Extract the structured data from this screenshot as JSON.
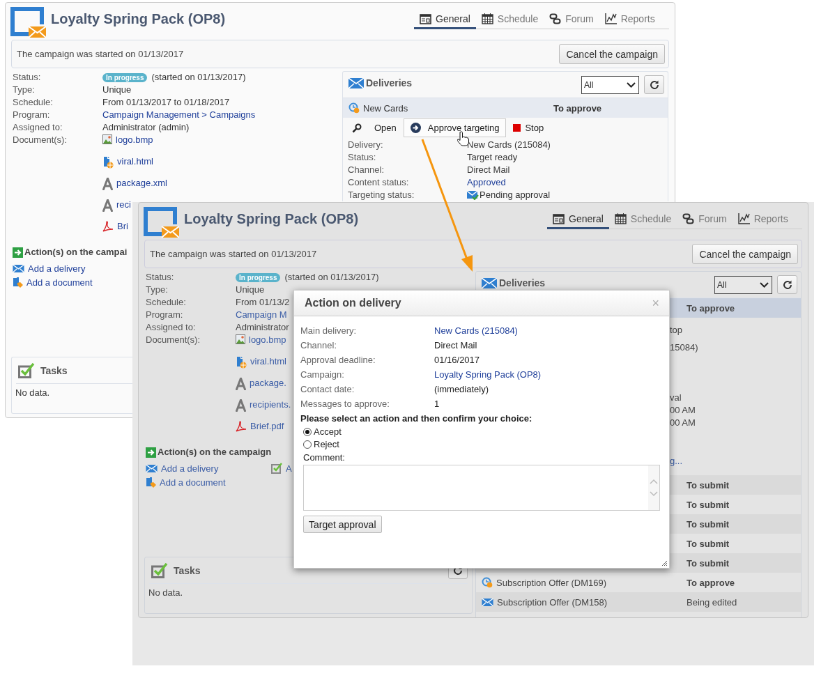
{
  "back_screen": {
    "dimmed": false,
    "title": "Loyalty Spring Pack (OP8)",
    "tabs": [
      {
        "kind": "general",
        "label": "General",
        "selected": true
      },
      {
        "kind": "schedule",
        "label": "Schedule",
        "selected": false
      },
      {
        "kind": "forum",
        "label": "Forum",
        "selected": false
      },
      {
        "kind": "reports",
        "label": "Reports",
        "selected": false
      }
    ],
    "banner": {
      "message": "The campaign was started on 01/13/2017",
      "button": "Cancel the campaign"
    },
    "details": [
      {
        "label": "Status:",
        "badge": "In progress",
        "value": "(started on 01/13/2017)",
        "link": false
      },
      {
        "label": "Type:",
        "value": "Unique",
        "link": false
      },
      {
        "label": "Schedule:",
        "value": "From 01/13/2017 to 01/18/2017",
        "link": false
      },
      {
        "label": "Program:",
        "value": "Campaign Management > Campaigns",
        "link": true
      },
      {
        "label": "Assigned to:",
        "value": "Administrator (admin)",
        "link": false
      }
    ],
    "documents_label": "Document(s):",
    "documents": [
      {
        "kind": "image",
        "name": "logo.bmp"
      },
      {
        "kind": "web",
        "name": "viral.html"
      },
      {
        "kind": "text",
        "name": "package.xml"
      },
      {
        "kind": "text",
        "name": "reci"
      },
      {
        "kind": "pdf",
        "name": "Bri"
      }
    ],
    "actions_title": "Action(s) on the campai",
    "actions": [
      {
        "kind": "delivery",
        "label": "Add a delivery"
      },
      {
        "kind": "document",
        "label": "Add a document"
      }
    ],
    "tasks": {
      "title": "Tasks",
      "empty": "No data.",
      "refresh_button": false
    },
    "deliveries": {
      "title": "Deliveries",
      "filter": "All",
      "rows": [
        {
          "name": "New Cards",
          "status": "To approve",
          "awaiting": true,
          "selected": true,
          "actions": [
            {
              "kind": "open",
              "label": "Open",
              "hovered": false
            },
            {
              "kind": "approve",
              "label": "Approve targeting",
              "hovered": true
            },
            {
              "kind": "stop",
              "label": "Stop",
              "hovered": false
            }
          ],
          "details": [
            {
              "label": "Delivery:",
              "value": "New Cards (215084)",
              "kind": "plain"
            },
            {
              "label": "Status:",
              "value": "Target ready",
              "kind": "plain"
            },
            {
              "label": "Channel:",
              "value": "Direct Mail",
              "kind": "plain"
            },
            {
              "label": "Content status:",
              "value": "Approved",
              "kind": "link"
            },
            {
              "label": "Targeting status:",
              "value": "Pending approval",
              "kind": "mail"
            }
          ]
        }
      ]
    }
  },
  "front_screen": {
    "dimmed": true,
    "title": "Loyalty Spring Pack (OP8)",
    "tabs": [
      {
        "kind": "general",
        "label": "General",
        "selected": true
      },
      {
        "kind": "schedule",
        "label": "Schedule",
        "selected": false
      },
      {
        "kind": "forum",
        "label": "Forum",
        "selected": false
      },
      {
        "kind": "reports",
        "label": "Reports",
        "selected": false
      }
    ],
    "banner": {
      "message": "The campaign was started on 01/13/2017",
      "button": "Cancel the campaign"
    },
    "details": [
      {
        "label": "Status:",
        "badge": "In progress",
        "value": "(started on 01/13/2017)",
        "link": false
      },
      {
        "label": "Type:",
        "value": "Unique",
        "link": false
      },
      {
        "label": "Schedule:",
        "value": "From 01/13/2",
        "link": false
      },
      {
        "label": "Program:",
        "value": "Campaign M",
        "link": true
      },
      {
        "label": "Assigned to:",
        "value": "Administrator",
        "link": false
      }
    ],
    "documents_label": "Document(s):",
    "documents": [
      {
        "kind": "image",
        "name": "logo.bmp"
      },
      {
        "kind": "web",
        "name": "viral.html"
      },
      {
        "kind": "text",
        "name": "package."
      },
      {
        "kind": "text",
        "name": "recipients."
      },
      {
        "kind": "pdf",
        "name": "Brief.pdf"
      }
    ],
    "actions_title": "Action(s) on the campaign",
    "actions": [
      {
        "kind": "delivery",
        "label": "Add a delivery"
      },
      {
        "kind": "document",
        "label": "Add a document"
      },
      {
        "kind": "task",
        "label": "A"
      }
    ],
    "tasks": {
      "title": "Tasks",
      "empty": "No data.",
      "refresh_button": true
    },
    "deliveries": {
      "title": "Deliveries",
      "filter": "All",
      "rows": [
        {
          "status": "To approve",
          "awaiting": true,
          "selected": true,
          "fragments": [
            {
              "text": "top",
              "kind": "plain"
            },
            {
              "text": "15084)",
              "kind": "plain"
            },
            {
              "text": "val",
              "kind": "plain"
            },
            {
              "text": "00 AM",
              "kind": "plain"
            },
            {
              "text": "00 AM",
              "kind": "plain"
            },
            {
              "text": "g...",
              "kind": "link"
            }
          ]
        },
        {
          "status": "To submit",
          "awaiting": true,
          "selected": false
        },
        {
          "status": "To submit",
          "awaiting": true,
          "selected": false
        },
        {
          "status": "To submit",
          "awaiting": true,
          "selected": false
        },
        {
          "status": "To submit",
          "awaiting": true,
          "selected": false
        },
        {
          "status": "To submit",
          "awaiting": true,
          "selected": false
        },
        {
          "name": "Subscription Offer (DM169)",
          "status": "To approve",
          "awaiting": true,
          "selected": false
        },
        {
          "name": "Subscription Offer (DM158)",
          "status": "Being edited",
          "awaiting": false,
          "selected": false
        }
      ]
    }
  },
  "dialog": {
    "title": "Action on delivery",
    "close": "×",
    "fields": [
      {
        "label": "Main delivery:",
        "value": "New Cards (215084)",
        "link": true
      },
      {
        "label": "Channel:",
        "value": "Direct Mail",
        "link": false
      },
      {
        "label": "Approval deadline:",
        "value": "01/16/2017",
        "link": false
      },
      {
        "label": "Campaign:",
        "value": "Loyalty Spring Pack (OP8)",
        "link": true
      },
      {
        "label": "Contact date:",
        "value": "(immediately)",
        "link": false
      },
      {
        "label": "Messages to approve:",
        "value": "1",
        "link": false
      }
    ],
    "prompt": "Please select an action and then confirm your choice:",
    "choices": [
      {
        "label": "Accept",
        "selected": true
      },
      {
        "label": "Reject",
        "selected": false
      }
    ],
    "comment_label": "Comment:",
    "submit": "Target approval"
  }
}
